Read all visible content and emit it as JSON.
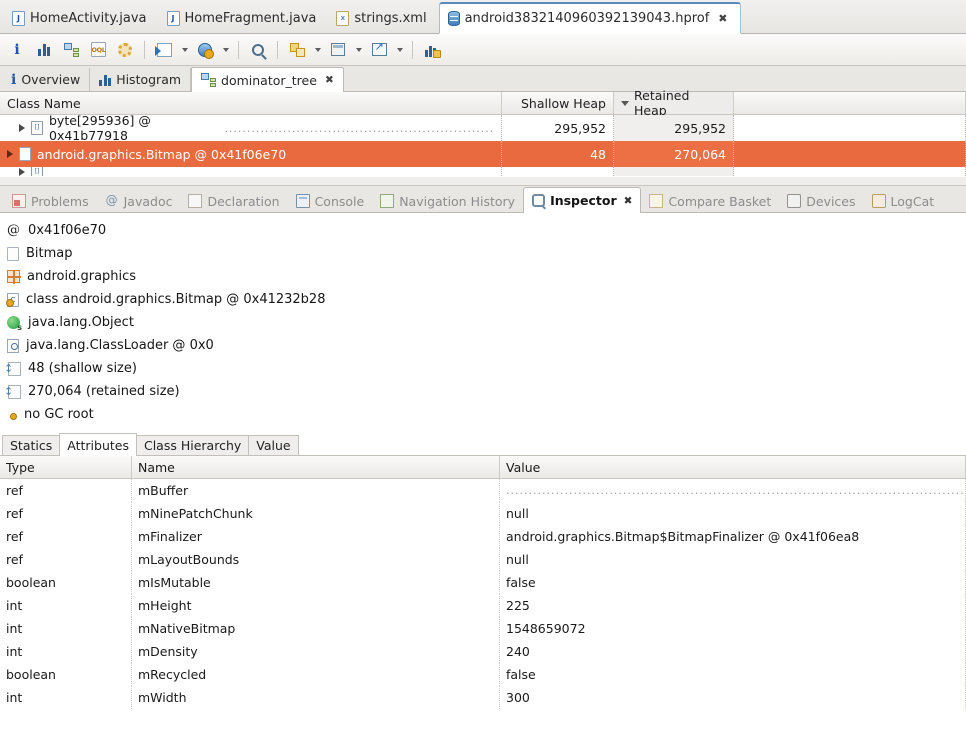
{
  "editor_tabs": [
    {
      "label": "HomeActivity.java",
      "icon": "java-file-icon",
      "active": false,
      "closable": false
    },
    {
      "label": "HomeFragment.java",
      "icon": "java-file-icon",
      "active": false,
      "closable": false
    },
    {
      "label": "strings.xml",
      "icon": "xml-file-icon",
      "active": false,
      "closable": false
    },
    {
      "label": "android3832140960392139043.hprof",
      "icon": "heap-dump-icon",
      "active": true,
      "closable": true
    }
  ],
  "toolbar": {
    "buttons": [
      {
        "name": "overview-info-button",
        "icon": "info-icon"
      },
      {
        "name": "histogram-button",
        "icon": "histogram-icon"
      },
      {
        "name": "dominator-tree-button",
        "icon": "tree-icon"
      },
      {
        "name": "oql-button",
        "icon": "oql-icon"
      },
      {
        "name": "query-browser-button",
        "icon": "gear-icon"
      },
      {
        "name": "run-expert-system-button",
        "icon": "run-icon",
        "dropdown": true
      },
      {
        "name": "heap-dump-history-button",
        "icon": "heapdump-config-icon",
        "dropdown": true
      },
      {
        "name": "find-button",
        "icon": "search-icon"
      },
      {
        "name": "group-by-button",
        "icon": "copy-icon",
        "dropdown": true
      },
      {
        "name": "calculate-retained-size-button",
        "icon": "table-icon",
        "dropdown": true
      },
      {
        "name": "export-button",
        "icon": "export-icon",
        "dropdown": true
      },
      {
        "name": "compare-snapshot-button",
        "icon": "calc-chart-icon"
      }
    ]
  },
  "view_tabs": [
    {
      "label": "Overview",
      "icon": "info-icon",
      "active": false,
      "closable": false
    },
    {
      "label": "Histogram",
      "icon": "histogram-icon",
      "active": false,
      "closable": false
    },
    {
      "label": "dominator_tree",
      "icon": "tree-icon",
      "active": true,
      "closable": true
    }
  ],
  "tree_table": {
    "columns": [
      {
        "label": "Class Name",
        "sorted": false
      },
      {
        "label": "Shallow Heap",
        "sorted": false
      },
      {
        "label": "Retained Heap",
        "sorted": true,
        "sort_dir": "desc"
      }
    ],
    "rows": [
      {
        "class_name": "byte[295936] @ 0x41b77918",
        "shallow_heap": "295,952",
        "retained_heap": "295,952",
        "icon": "array-icon",
        "expanded": false,
        "selected": false
      },
      {
        "class_name": "android.graphics.Bitmap @ 0x41f06e70",
        "shallow_heap": "48",
        "retained_heap": "270,064",
        "icon": "object-icon",
        "expanded": false,
        "selected": true
      }
    ]
  },
  "view_stack_tabs": [
    {
      "label": "Problems",
      "icon": "problems-icon",
      "active": false,
      "closable": false
    },
    {
      "label": "Javadoc",
      "icon": "javadoc-icon",
      "active": false,
      "closable": false
    },
    {
      "label": "Declaration",
      "icon": "declaration-icon",
      "active": false,
      "closable": false
    },
    {
      "label": "Console",
      "icon": "console-icon",
      "active": false,
      "closable": false
    },
    {
      "label": "Navigation History",
      "icon": "navigation-history-icon",
      "active": false,
      "closable": false
    },
    {
      "label": "Inspector",
      "icon": "inspector-icon",
      "active": true,
      "closable": true
    },
    {
      "label": "Compare Basket",
      "icon": "compare-basket-icon",
      "active": false,
      "closable": false
    },
    {
      "label": "Devices",
      "icon": "devices-icon",
      "active": false,
      "closable": false
    },
    {
      "label": "LogCat",
      "icon": "logcat-icon",
      "active": false,
      "closable": false
    }
  ],
  "inspector": {
    "rows": [
      {
        "label": "0x41f06e70",
        "icon": "address-at-icon"
      },
      {
        "label": "Bitmap",
        "icon": "class-simple-name-icon"
      },
      {
        "label": "android.graphics",
        "icon": "package-icon"
      },
      {
        "label": "class android.graphics.Bitmap @ 0x41232b28",
        "icon": "class-object-icon"
      },
      {
        "label": "java.lang.Object",
        "icon": "superclass-icon"
      },
      {
        "label": "java.lang.ClassLoader @ 0x0",
        "icon": "classloader-icon"
      },
      {
        "label": "48 (shallow size)",
        "icon": "shallow-size-icon"
      },
      {
        "label": "270,064 (retained size)",
        "icon": "retained-size-icon"
      },
      {
        "label": "no GC root",
        "icon": "gc-root-icon"
      }
    ]
  },
  "sub_tabs": [
    {
      "label": "Statics",
      "active": false
    },
    {
      "label": "Attributes",
      "active": true
    },
    {
      "label": "Class Hierarchy",
      "active": false
    },
    {
      "label": "Value",
      "active": false
    }
  ],
  "attributes_table": {
    "columns": [
      "Type",
      "Name",
      "Value"
    ],
    "rows": [
      {
        "type": "ref",
        "name": "mBuffer",
        "value": "",
        "value_is_dots": true
      },
      {
        "type": "ref",
        "name": "mNinePatchChunk",
        "value": "null",
        "value_is_dots": false
      },
      {
        "type": "ref",
        "name": "mFinalizer",
        "value": "android.graphics.Bitmap$BitmapFinalizer @ 0x41f06ea8",
        "value_is_dots": false
      },
      {
        "type": "ref",
        "name": "mLayoutBounds",
        "value": "null",
        "value_is_dots": false
      },
      {
        "type": "boolean",
        "name": "mIsMutable",
        "value": "false",
        "value_is_dots": false
      },
      {
        "type": "int",
        "name": "mHeight",
        "value": "225",
        "value_is_dots": false
      },
      {
        "type": "int",
        "name": "mNativeBitmap",
        "value": "1548659072",
        "value_is_dots": false
      },
      {
        "type": "int",
        "name": "mDensity",
        "value": "240",
        "value_is_dots": false
      },
      {
        "type": "boolean",
        "name": "mRecycled",
        "value": "false",
        "value_is_dots": false
      },
      {
        "type": "int",
        "name": "mWidth",
        "value": "300",
        "value_is_dots": false
      }
    ]
  },
  "colors": {
    "selection_orange": "#ea6a3f",
    "toolbar_bg": "#eeece8",
    "tab_bg": "#e9e7e3",
    "sorted_column_bg": "#f0efed"
  }
}
